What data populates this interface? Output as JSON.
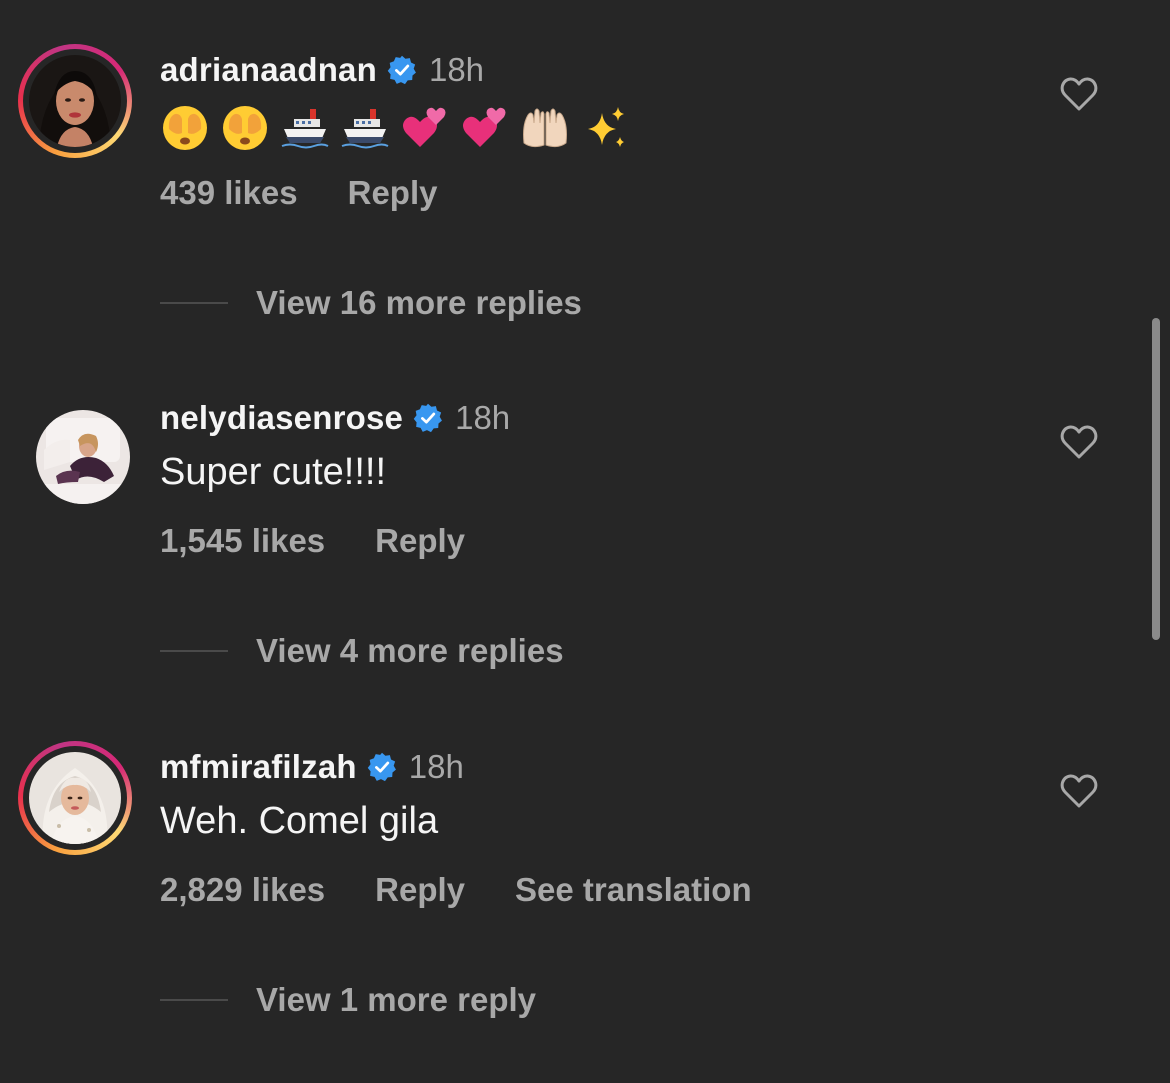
{
  "comments": [
    {
      "username": "adrianaadnan",
      "verified": true,
      "time": "18h",
      "text": "",
      "emojis": [
        "face-with-hands-over-eyes",
        "face-with-hands-over-eyes",
        "ship",
        "ship",
        "revolving-hearts",
        "revolving-hearts",
        "palms-up-together",
        "sparkles"
      ],
      "likes": "439 likes",
      "reply_label": "Reply",
      "view_replies": "View 16 more replies",
      "story_ring": true
    },
    {
      "username": "nelydiasenrose",
      "verified": true,
      "time": "18h",
      "text": "Super cute!!!!",
      "likes": "1,545 likes",
      "reply_label": "Reply",
      "view_replies": "View 4 more replies",
      "story_ring": false
    },
    {
      "username": "mfmirafilzah",
      "verified": true,
      "time": "18h",
      "text": "Weh. Comel gila",
      "likes": "2,829 likes",
      "reply_label": "Reply",
      "translation_label": "See translation",
      "view_replies": "View 1 more reply",
      "story_ring": true
    }
  ],
  "colors": {
    "background": "#262626",
    "primary_text": "#f5f5f5",
    "secondary_text": "#a8a8a8",
    "verified_badge": "#3897f0"
  }
}
